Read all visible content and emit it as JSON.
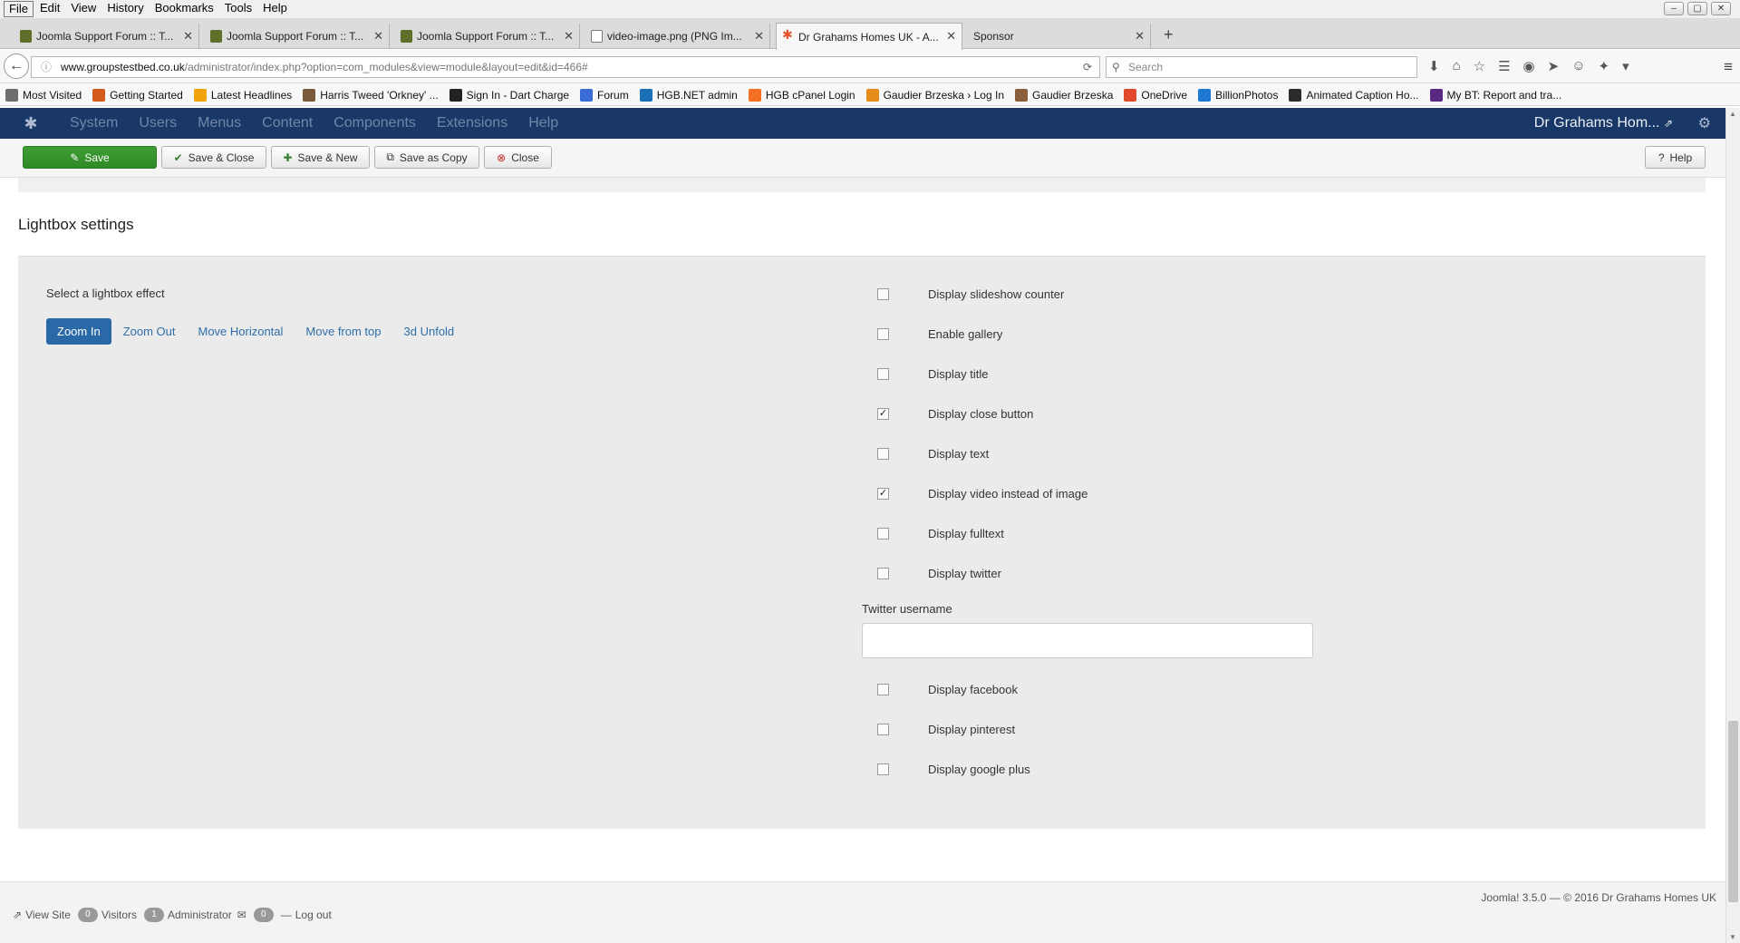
{
  "browser": {
    "menus": [
      "File",
      "Edit",
      "View",
      "History",
      "Bookmarks",
      "Tools",
      "Help"
    ],
    "tabs": [
      {
        "title": "Joomla Support Forum :: T..."
      },
      {
        "title": "Joomla Support Forum :: T..."
      },
      {
        "title": "Joomla Support Forum :: T..."
      },
      {
        "title": "video-image.png (PNG Im..."
      },
      {
        "title": "Dr Grahams Homes UK - A..."
      },
      {
        "title": "Sponsor"
      }
    ],
    "url_host": "www.groupstestbed.co.uk",
    "url_path": "/administrator/index.php?option=com_modules&view=module&layout=edit&id=466#",
    "search_placeholder": "Search",
    "bookmarks": [
      {
        "label": "Most Visited",
        "color": "#6d6d6d"
      },
      {
        "label": "Getting Started",
        "color": "#d35a1c"
      },
      {
        "label": "Latest Headlines",
        "color": "#f0a30a"
      },
      {
        "label": "Harris Tweed 'Orkney' ...",
        "color": "#7a5a3a"
      },
      {
        "label": "Sign In - Dart Charge",
        "color": "#222222"
      },
      {
        "label": "Forum",
        "color": "#3a6bd6"
      },
      {
        "label": "HGB.NET admin",
        "color": "#1b6fb5"
      },
      {
        "label": "HGB cPanel Login",
        "color": "#f36f21"
      },
      {
        "label": "Gaudier Brzeska › Log In",
        "color": "#e58c1a"
      },
      {
        "label": "Gaudier Brzeska",
        "color": "#8b5e3c"
      },
      {
        "label": "OneDrive",
        "color": "#e04a2a"
      },
      {
        "label": "BillionPhotos",
        "color": "#1c78d3"
      },
      {
        "label": "Animated Caption Ho...",
        "color": "#2c2c2c"
      },
      {
        "label": "My BT: Report and tra...",
        "color": "#5a2a82"
      }
    ]
  },
  "joomla": {
    "nav": [
      "System",
      "Users",
      "Menus",
      "Content",
      "Components",
      "Extensions",
      "Help"
    ],
    "site_name": "Dr Grahams Hom...",
    "toolbar": {
      "save": "Save",
      "save_close": "Save & Close",
      "save_new": "Save & New",
      "save_copy": "Save as Copy",
      "close": "Close",
      "help": "Help"
    },
    "section_title": "Lightbox settings",
    "effect_label": "Select a lightbox effect",
    "effects": [
      "Zoom In",
      "Zoom Out",
      "Move Horizontal",
      "Move from top",
      "3d Unfold"
    ],
    "selected_effect": "Zoom In",
    "options": [
      {
        "label": "Display slideshow counter",
        "checked": false
      },
      {
        "label": "Enable gallery",
        "checked": false
      },
      {
        "label": "Display title",
        "checked": false
      },
      {
        "label": "Display close button",
        "checked": true
      },
      {
        "label": "Display text",
        "checked": false
      },
      {
        "label": "Display video instead of image",
        "checked": true
      },
      {
        "label": "Display fulltext",
        "checked": false
      },
      {
        "label": "Display twitter",
        "checked": false
      }
    ],
    "twitter_label": "Twitter username",
    "twitter_value": "",
    "social_options": [
      {
        "label": "Display facebook",
        "checked": false
      },
      {
        "label": "Display pinterest",
        "checked": false
      },
      {
        "label": "Display google plus",
        "checked": false
      }
    ],
    "footer": {
      "version": "Joomla! 3.5.0 — © 2016 Dr Grahams Homes UK",
      "view_site": "View Site",
      "visitors_count": "0",
      "visitors": "Visitors",
      "admin_count": "1",
      "admin": "Administrator",
      "messages_count": "0",
      "logout": "Log out"
    }
  },
  "colors": {
    "joomla_nav": "#1a3867",
    "save_green": "#2f8a26",
    "effect_active": "#2a69a8"
  }
}
